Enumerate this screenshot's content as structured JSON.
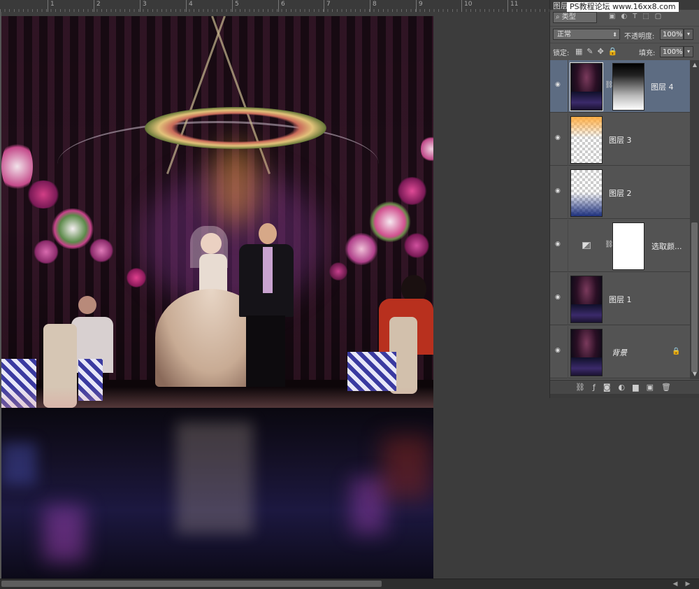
{
  "ruler": {
    "marks": [
      "1",
      "2",
      "3",
      "4",
      "5",
      "6",
      "7",
      "8",
      "9",
      "10",
      "11"
    ]
  },
  "panel": {
    "title": "图层",
    "watermark": "PS教程论坛 www.16xx8.com",
    "filter_kind": "类型",
    "blend_mode": "正常",
    "opacity_label": "不透明度:",
    "opacity_value": "100%",
    "lock_label": "锁定:",
    "fill_label": "填充:",
    "fill_value": "100%"
  },
  "layers": [
    {
      "name": "图层 4",
      "thumb": "photo",
      "mask": "gradient",
      "active": true
    },
    {
      "name": "图层 3",
      "thumb": "orange-top"
    },
    {
      "name": "图层 2",
      "thumb": "blue-bottom"
    },
    {
      "name": "选取颜...",
      "thumb": "adjustment",
      "mask": "white"
    },
    {
      "name": "图层 1",
      "thumb": "photo"
    },
    {
      "name": "背景",
      "thumb": "photo",
      "locked": true
    }
  ],
  "icons": {
    "visibility": "eye-icon",
    "link": "chain-icon",
    "lock": "lock-icon"
  },
  "colors": {
    "panel_bg": "#535353",
    "active_layer": "#5d6c82",
    "workspace": "#3c3c3c"
  }
}
